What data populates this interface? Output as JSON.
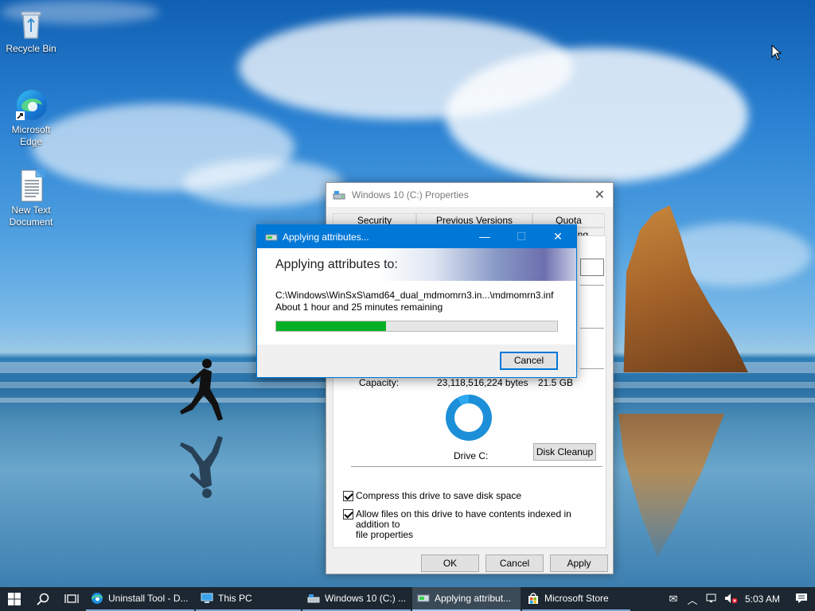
{
  "desktop": {
    "icons": [
      {
        "label": "Recycle Bin"
      },
      {
        "label": "Microsoft Edge"
      },
      {
        "label": "New Text Document"
      }
    ]
  },
  "properties_window": {
    "title": "Windows 10 (C:) Properties",
    "tabs_top": [
      "Security",
      "Previous Versions",
      "Quota"
    ],
    "tab_partial": "ing",
    "capacity_label": "Capacity:",
    "capacity_bytes": "23,118,516,224 bytes",
    "capacity_gb": "21.5 GB",
    "drive_label": "Drive C:",
    "disk_cleanup_label": "Disk Cleanup",
    "compress_label": "Compress this drive to save disk space",
    "compress_checked": true,
    "index_label_line1": "Allow files on this drive to have contents indexed in addition to",
    "index_label_line2": "file properties",
    "index_checked": true,
    "ok_label": "OK",
    "cancel_label": "Cancel",
    "apply_label": "Apply"
  },
  "apply_dialog": {
    "title": "Applying attributes...",
    "banner_text": "Applying attributes to:",
    "path": "C:\\Windows\\WinSxS\\amd64_dual_mdmomrn3.in...\\mdmomrn3.inf",
    "remaining": "About 1 hour and 25 minutes remaining",
    "progress_fraction": 0.39,
    "cancel_label": "Cancel",
    "progress_color": "#06b025"
  },
  "taskbar": {
    "apps": [
      {
        "label": "Uninstall Tool - D...",
        "icon": "edge-icon"
      },
      {
        "label": "This PC",
        "icon": "computer-icon"
      },
      {
        "label": "Windows 10 (C:) ...",
        "icon": "drive-icon"
      },
      {
        "label": "Applying attribut...",
        "icon": "attributes-icon",
        "active": true
      },
      {
        "label": "Microsoft Store",
        "icon": "store-icon"
      }
    ],
    "clock": "5:03 AM"
  },
  "colors": {
    "accent": "#0078d7",
    "taskbar": "#1c2731"
  }
}
